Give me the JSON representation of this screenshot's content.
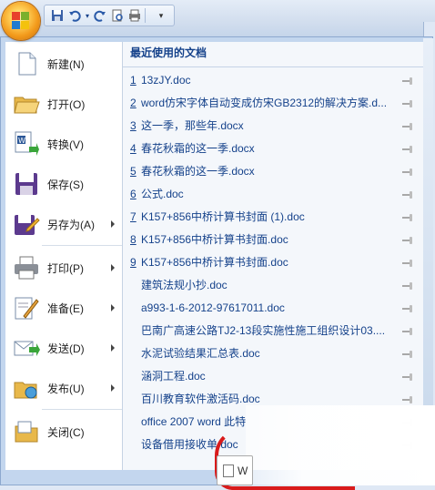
{
  "quick_access": {
    "save_icon": "save-icon",
    "undo_icon": "undo-icon",
    "redo_icon": "redo-icon",
    "preview_icon": "print-preview-icon",
    "print_icon": "print-icon"
  },
  "office_menu": {
    "items": [
      {
        "label": "新建(N)",
        "icon": "new-document-icon",
        "submenu": false
      },
      {
        "label": "打开(O)",
        "icon": "open-folder-icon",
        "submenu": false
      },
      {
        "label": "转换(V)",
        "icon": "convert-icon",
        "submenu": false
      },
      {
        "label": "保存(S)",
        "icon": "save-disk-icon",
        "submenu": false
      },
      {
        "label": "另存为(A)",
        "icon": "save-as-icon",
        "submenu": true
      },
      {
        "label": "打印(P)",
        "icon": "printer-icon",
        "submenu": true
      },
      {
        "label": "准备(E)",
        "icon": "prepare-icon",
        "submenu": true
      },
      {
        "label": "发送(D)",
        "icon": "send-icon",
        "submenu": true
      },
      {
        "label": "发布(U)",
        "icon": "publish-icon",
        "submenu": true
      },
      {
        "label": "关闭(C)",
        "icon": "close-folder-icon",
        "submenu": false
      }
    ]
  },
  "recent": {
    "title": "最近使用的文档",
    "items": [
      {
        "num": "1",
        "name": "13zJY.doc"
      },
      {
        "num": "2",
        "name": "word仿宋字体自动变成仿宋GB2312的解决方案.d..."
      },
      {
        "num": "3",
        "name": "这一季，那些年.docx"
      },
      {
        "num": "4",
        "name": "春花秋霜的这一季.docx"
      },
      {
        "num": "5",
        "name": "春花秋霜的这一季.docx"
      },
      {
        "num": "6",
        "name": "公式.doc"
      },
      {
        "num": "7",
        "name": "K157+856中桥计算书封面 (1).doc"
      },
      {
        "num": "8",
        "name": "K157+856中桥计算书封面.doc"
      },
      {
        "num": "9",
        "name": "K157+856中桥计算书封面.doc"
      },
      {
        "num": "",
        "name": "建筑法规小抄.doc"
      },
      {
        "num": "",
        "name": "a993-1-6-2012-97617011.doc"
      },
      {
        "num": "",
        "name": "巴南广高速公路TJ2-13段实施性施工组织设计03...."
      },
      {
        "num": "",
        "name": "水泥试验结果汇总表.doc"
      },
      {
        "num": "",
        "name": "涵洞工程.doc"
      },
      {
        "num": "",
        "name": "百川教育软件激活码.doc"
      },
      {
        "num": "",
        "name": "office 2007 word 此特"
      },
      {
        "num": "",
        "name": "设备借用接收单.doc"
      }
    ]
  },
  "taskbar": {
    "label": "W"
  }
}
